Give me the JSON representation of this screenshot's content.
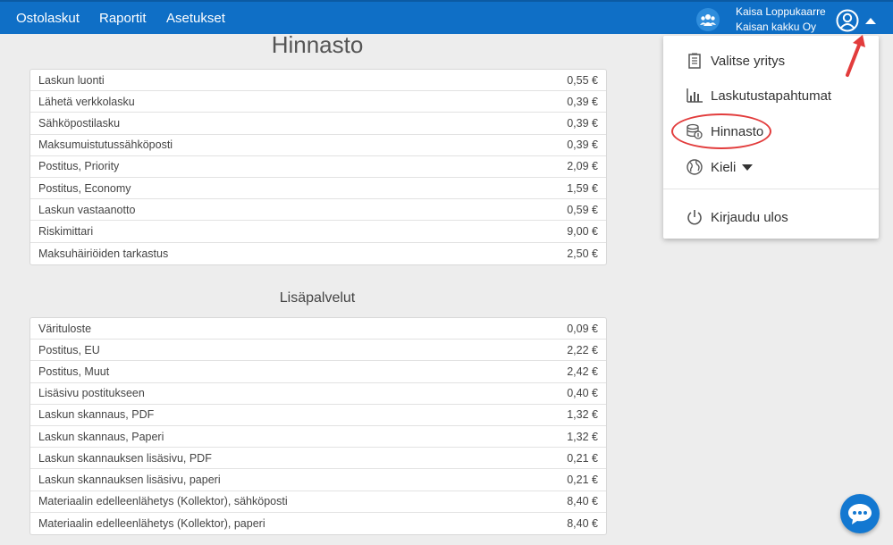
{
  "nav": {
    "items": [
      "Ostolaskut",
      "Raportit",
      "Asetukset"
    ]
  },
  "user": {
    "name": "Kaisa Loppukaarre",
    "company": "Kaisan kakku Oy"
  },
  "page": {
    "title": "Hinnasto",
    "section_title": "Lisäpalvelut"
  },
  "prices": [
    {
      "label": "Laskun luonti",
      "price": "0,55 €"
    },
    {
      "label": "Lähetä verkkolasku",
      "price": "0,39 €"
    },
    {
      "label": "Sähköpostilasku",
      "price": "0,39 €"
    },
    {
      "label": "Maksumuistutussähköposti",
      "price": "0,39 €"
    },
    {
      "label": "Postitus, Priority",
      "price": "2,09 €"
    },
    {
      "label": "Postitus, Economy",
      "price": "1,59 €"
    },
    {
      "label": "Laskun vastaanotto",
      "price": "0,59 €"
    },
    {
      "label": "Riskimittari",
      "price": "9,00 €"
    },
    {
      "label": "Maksuhäiriöiden tarkastus",
      "price": "2,50 €"
    }
  ],
  "extras": [
    {
      "label": "Värituloste",
      "price": "0,09 €"
    },
    {
      "label": "Postitus, EU",
      "price": "2,22 €"
    },
    {
      "label": "Postitus, Muut",
      "price": "2,42 €"
    },
    {
      "label": "Lisäsivu postitukseen",
      "price": "0,40 €"
    },
    {
      "label": "Laskun skannaus, PDF",
      "price": "1,32 €"
    },
    {
      "label": "Laskun skannaus, Paperi",
      "price": "1,32 €"
    },
    {
      "label": "Laskun skannauksen lisäsivu, PDF",
      "price": "0,21 €"
    },
    {
      "label": "Laskun skannauksen lisäsivu, paperi",
      "price": "0,21 €"
    },
    {
      "label": "Materiaalin edelleenlähetys (Kollektor), sähköposti",
      "price": "8,40 €"
    },
    {
      "label": "Materiaalin edelleenlähetys (Kollektor), paperi",
      "price": "8,40 €"
    }
  ],
  "menu": {
    "items": [
      "Valitse yritys",
      "Laskutustapahtumat",
      "Hinnasto",
      "Kieli",
      "Kirjaudu ulos"
    ]
  },
  "colors": {
    "navbar": "#0f6fc6",
    "annotation": "#e23c3c",
    "chat": "#1378d1"
  }
}
